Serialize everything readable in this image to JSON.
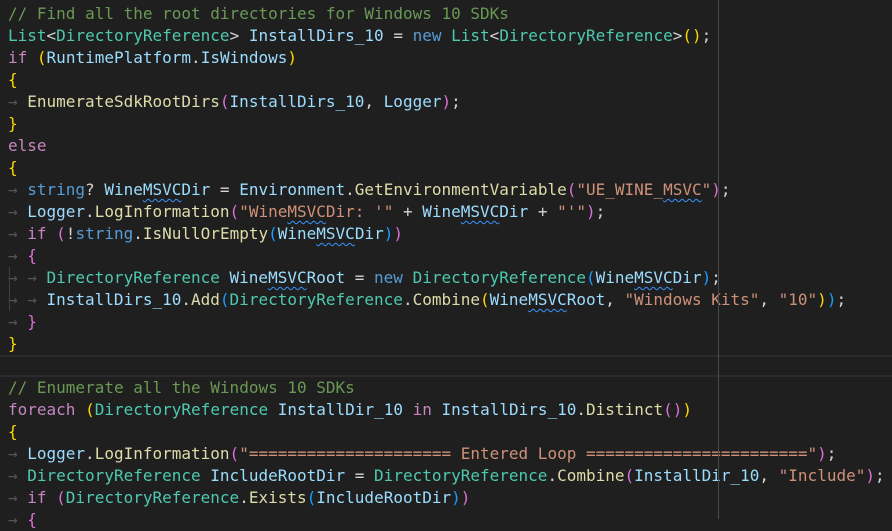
{
  "editor": {
    "lines": [
      {
        "indent": 0,
        "tokens": [
          {
            "t": "// Find all the root directories for Windows 10 SDKs",
            "c": "cm"
          }
        ]
      },
      {
        "indent": 0,
        "tokens": [
          {
            "t": "List",
            "c": "ty"
          },
          {
            "t": "<"
          },
          {
            "t": "DirectoryReference",
            "c": "ty"
          },
          {
            "t": "> "
          },
          {
            "t": "InstallDirs_10",
            "c": "va"
          },
          {
            "t": " = "
          },
          {
            "t": "new",
            "c": "kw"
          },
          {
            "t": " "
          },
          {
            "t": "List",
            "c": "ty"
          },
          {
            "t": "<"
          },
          {
            "t": "DirectoryReference",
            "c": "ty"
          },
          {
            "t": ">"
          },
          {
            "t": "(",
            "c": "b1"
          },
          {
            "t": ")",
            "c": "b1"
          },
          {
            "t": ";"
          }
        ]
      },
      {
        "indent": 0,
        "tokens": [
          {
            "t": "if",
            "c": "ctl"
          },
          {
            "t": " "
          },
          {
            "t": "(",
            "c": "b1"
          },
          {
            "t": "RuntimePlatform",
            "c": "va"
          },
          {
            "t": "."
          },
          {
            "t": "IsWindows",
            "c": "va"
          },
          {
            "t": ")",
            "c": "b1"
          }
        ]
      },
      {
        "indent": 0,
        "tokens": [
          {
            "t": "{",
            "c": "b1"
          }
        ]
      },
      {
        "indent": 1,
        "tokens": [
          {
            "t": "EnumerateSdkRootDirs",
            "c": "fn"
          },
          {
            "t": "(",
            "c": "b2"
          },
          {
            "t": "InstallDirs_10",
            "c": "va"
          },
          {
            "t": ", "
          },
          {
            "t": "Logger",
            "c": "va"
          },
          {
            "t": ")",
            "c": "b2"
          },
          {
            "t": ";"
          }
        ]
      },
      {
        "indent": 0,
        "tokens": [
          {
            "t": "}",
            "c": "b1"
          }
        ]
      },
      {
        "indent": 0,
        "tokens": [
          {
            "t": "else",
            "c": "ctl"
          }
        ]
      },
      {
        "indent": 0,
        "tokens": [
          {
            "t": "{",
            "c": "b1"
          }
        ]
      },
      {
        "indent": 1,
        "tokens": [
          {
            "t": "string",
            "c": "kw"
          },
          {
            "t": "? "
          },
          {
            "t": "Wine",
            "c": "va"
          },
          {
            "t": "MSVC",
            "c": "va sq"
          },
          {
            "t": "Dir",
            "c": "va"
          },
          {
            "t": " = "
          },
          {
            "t": "Environment",
            "c": "va"
          },
          {
            "t": "."
          },
          {
            "t": "GetEnvironmentVariable",
            "c": "fn"
          },
          {
            "t": "(",
            "c": "b2"
          },
          {
            "t": "\"UE_WINE_",
            "c": "st"
          },
          {
            "t": "MSVC",
            "c": "st sq"
          },
          {
            "t": "\"",
            "c": "st"
          },
          {
            "t": ")",
            "c": "b2"
          },
          {
            "t": ";"
          }
        ]
      },
      {
        "indent": 1,
        "tokens": [
          {
            "t": "Logger",
            "c": "va"
          },
          {
            "t": "."
          },
          {
            "t": "LogInformation",
            "c": "fn"
          },
          {
            "t": "(",
            "c": "b2"
          },
          {
            "t": "\"Wine",
            "c": "st"
          },
          {
            "t": "MSVC",
            "c": "st sq"
          },
          {
            "t": "Dir: '\"",
            "c": "st"
          },
          {
            "t": " + "
          },
          {
            "t": "Wine",
            "c": "va"
          },
          {
            "t": "MSVC",
            "c": "va sq"
          },
          {
            "t": "Dir",
            "c": "va"
          },
          {
            "t": " + "
          },
          {
            "t": "\"'\"",
            "c": "st"
          },
          {
            "t": ")",
            "c": "b2"
          },
          {
            "t": ";"
          }
        ]
      },
      {
        "indent": 1,
        "tokens": [
          {
            "t": "if",
            "c": "ctl"
          },
          {
            "t": " "
          },
          {
            "t": "(",
            "c": "b2"
          },
          {
            "t": "!"
          },
          {
            "t": "string",
            "c": "kw"
          },
          {
            "t": "."
          },
          {
            "t": "IsNullOrEmpty",
            "c": "fn"
          },
          {
            "t": "(",
            "c": "b3"
          },
          {
            "t": "Wine",
            "c": "va"
          },
          {
            "t": "MSVC",
            "c": "va sq"
          },
          {
            "t": "Dir",
            "c": "va"
          },
          {
            "t": ")",
            "c": "b3"
          },
          {
            "t": ")",
            "c": "b2"
          }
        ]
      },
      {
        "indent": 1,
        "tokens": [
          {
            "t": "{",
            "c": "b2"
          }
        ]
      },
      {
        "indent": 2,
        "tokens": [
          {
            "t": "DirectoryReference",
            "c": "ty"
          },
          {
            "t": " "
          },
          {
            "t": "Wine",
            "c": "va"
          },
          {
            "t": "MSVC",
            "c": "va sq"
          },
          {
            "t": "Root",
            "c": "va"
          },
          {
            "t": " = "
          },
          {
            "t": "new",
            "c": "kw"
          },
          {
            "t": " "
          },
          {
            "t": "DirectoryReference",
            "c": "ty"
          },
          {
            "t": "(",
            "c": "b3"
          },
          {
            "t": "Wine",
            "c": "va"
          },
          {
            "t": "MSVC",
            "c": "va sq"
          },
          {
            "t": "Dir",
            "c": "va"
          },
          {
            "t": ")",
            "c": "b3"
          },
          {
            "t": ";"
          }
        ]
      },
      {
        "indent": 2,
        "tokens": [
          {
            "t": "InstallDirs_10",
            "c": "va"
          },
          {
            "t": "."
          },
          {
            "t": "Add",
            "c": "fn"
          },
          {
            "t": "(",
            "c": "b3"
          },
          {
            "t": "DirectoryReference",
            "c": "ty"
          },
          {
            "t": "."
          },
          {
            "t": "Combine",
            "c": "fn"
          },
          {
            "t": "(",
            "c": "b1"
          },
          {
            "t": "Wine",
            "c": "va"
          },
          {
            "t": "MSVC",
            "c": "va sq"
          },
          {
            "t": "Root",
            "c": "va"
          },
          {
            "t": ", "
          },
          {
            "t": "\"Windows Kits\"",
            "c": "st"
          },
          {
            "t": ", "
          },
          {
            "t": "\"10\"",
            "c": "st"
          },
          {
            "t": ")",
            "c": "b1"
          },
          {
            "t": ")",
            "c": "b3"
          },
          {
            "t": ";"
          }
        ]
      },
      {
        "indent": 1,
        "tokens": [
          {
            "t": "}",
            "c": "b2"
          }
        ]
      },
      {
        "indent": 0,
        "tokens": [
          {
            "t": "}",
            "c": "b1"
          }
        ]
      },
      {
        "indent": 0,
        "current": true,
        "tokens": []
      },
      {
        "indent": 0,
        "tokens": [
          {
            "t": "// Enumerate all the Windows 10 SDKs",
            "c": "cm"
          }
        ]
      },
      {
        "indent": 0,
        "tokens": [
          {
            "t": "foreach",
            "c": "ctl"
          },
          {
            "t": " "
          },
          {
            "t": "(",
            "c": "b1"
          },
          {
            "t": "DirectoryReference",
            "c": "ty"
          },
          {
            "t": " "
          },
          {
            "t": "InstallDir_10",
            "c": "va"
          },
          {
            "t": " "
          },
          {
            "t": "in",
            "c": "ctl"
          },
          {
            "t": " "
          },
          {
            "t": "InstallDirs_10",
            "c": "va"
          },
          {
            "t": "."
          },
          {
            "t": "Distinct",
            "c": "fn"
          },
          {
            "t": "(",
            "c": "b2"
          },
          {
            "t": ")",
            "c": "b2"
          },
          {
            "t": ")",
            "c": "b1"
          }
        ]
      },
      {
        "indent": 0,
        "tokens": [
          {
            "t": "{",
            "c": "b1"
          }
        ]
      },
      {
        "indent": 1,
        "tokens": [
          {
            "t": "Logger",
            "c": "va"
          },
          {
            "t": "."
          },
          {
            "t": "LogInformation",
            "c": "fn"
          },
          {
            "t": "(",
            "c": "b2"
          },
          {
            "t": "\"===================== Entered Loop =======================\"",
            "c": "st"
          },
          {
            "t": ")",
            "c": "b2"
          },
          {
            "t": ";"
          }
        ]
      },
      {
        "indent": 1,
        "tokens": [
          {
            "t": "DirectoryReference",
            "c": "ty"
          },
          {
            "t": " "
          },
          {
            "t": "IncludeRootDir",
            "c": "va"
          },
          {
            "t": " = "
          },
          {
            "t": "DirectoryReference",
            "c": "ty"
          },
          {
            "t": "."
          },
          {
            "t": "Combine",
            "c": "fn"
          },
          {
            "t": "(",
            "c": "b2"
          },
          {
            "t": "InstallDir_10",
            "c": "va"
          },
          {
            "t": ", "
          },
          {
            "t": "\"Include\"",
            "c": "st"
          },
          {
            "t": ")",
            "c": "b2"
          },
          {
            "t": ";"
          }
        ]
      },
      {
        "indent": 1,
        "tokens": [
          {
            "t": "if",
            "c": "ctl"
          },
          {
            "t": " "
          },
          {
            "t": "(",
            "c": "b2"
          },
          {
            "t": "DirectoryReference",
            "c": "ty"
          },
          {
            "t": "."
          },
          {
            "t": "Exists",
            "c": "fn"
          },
          {
            "t": "(",
            "c": "b3"
          },
          {
            "t": "IncludeRootDir",
            "c": "va"
          },
          {
            "t": ")",
            "c": "b3"
          },
          {
            "t": ")",
            "c": "b2"
          }
        ]
      },
      {
        "indent": 1,
        "tokens": [
          {
            "t": "{",
            "c": "b2"
          }
        ]
      }
    ]
  }
}
